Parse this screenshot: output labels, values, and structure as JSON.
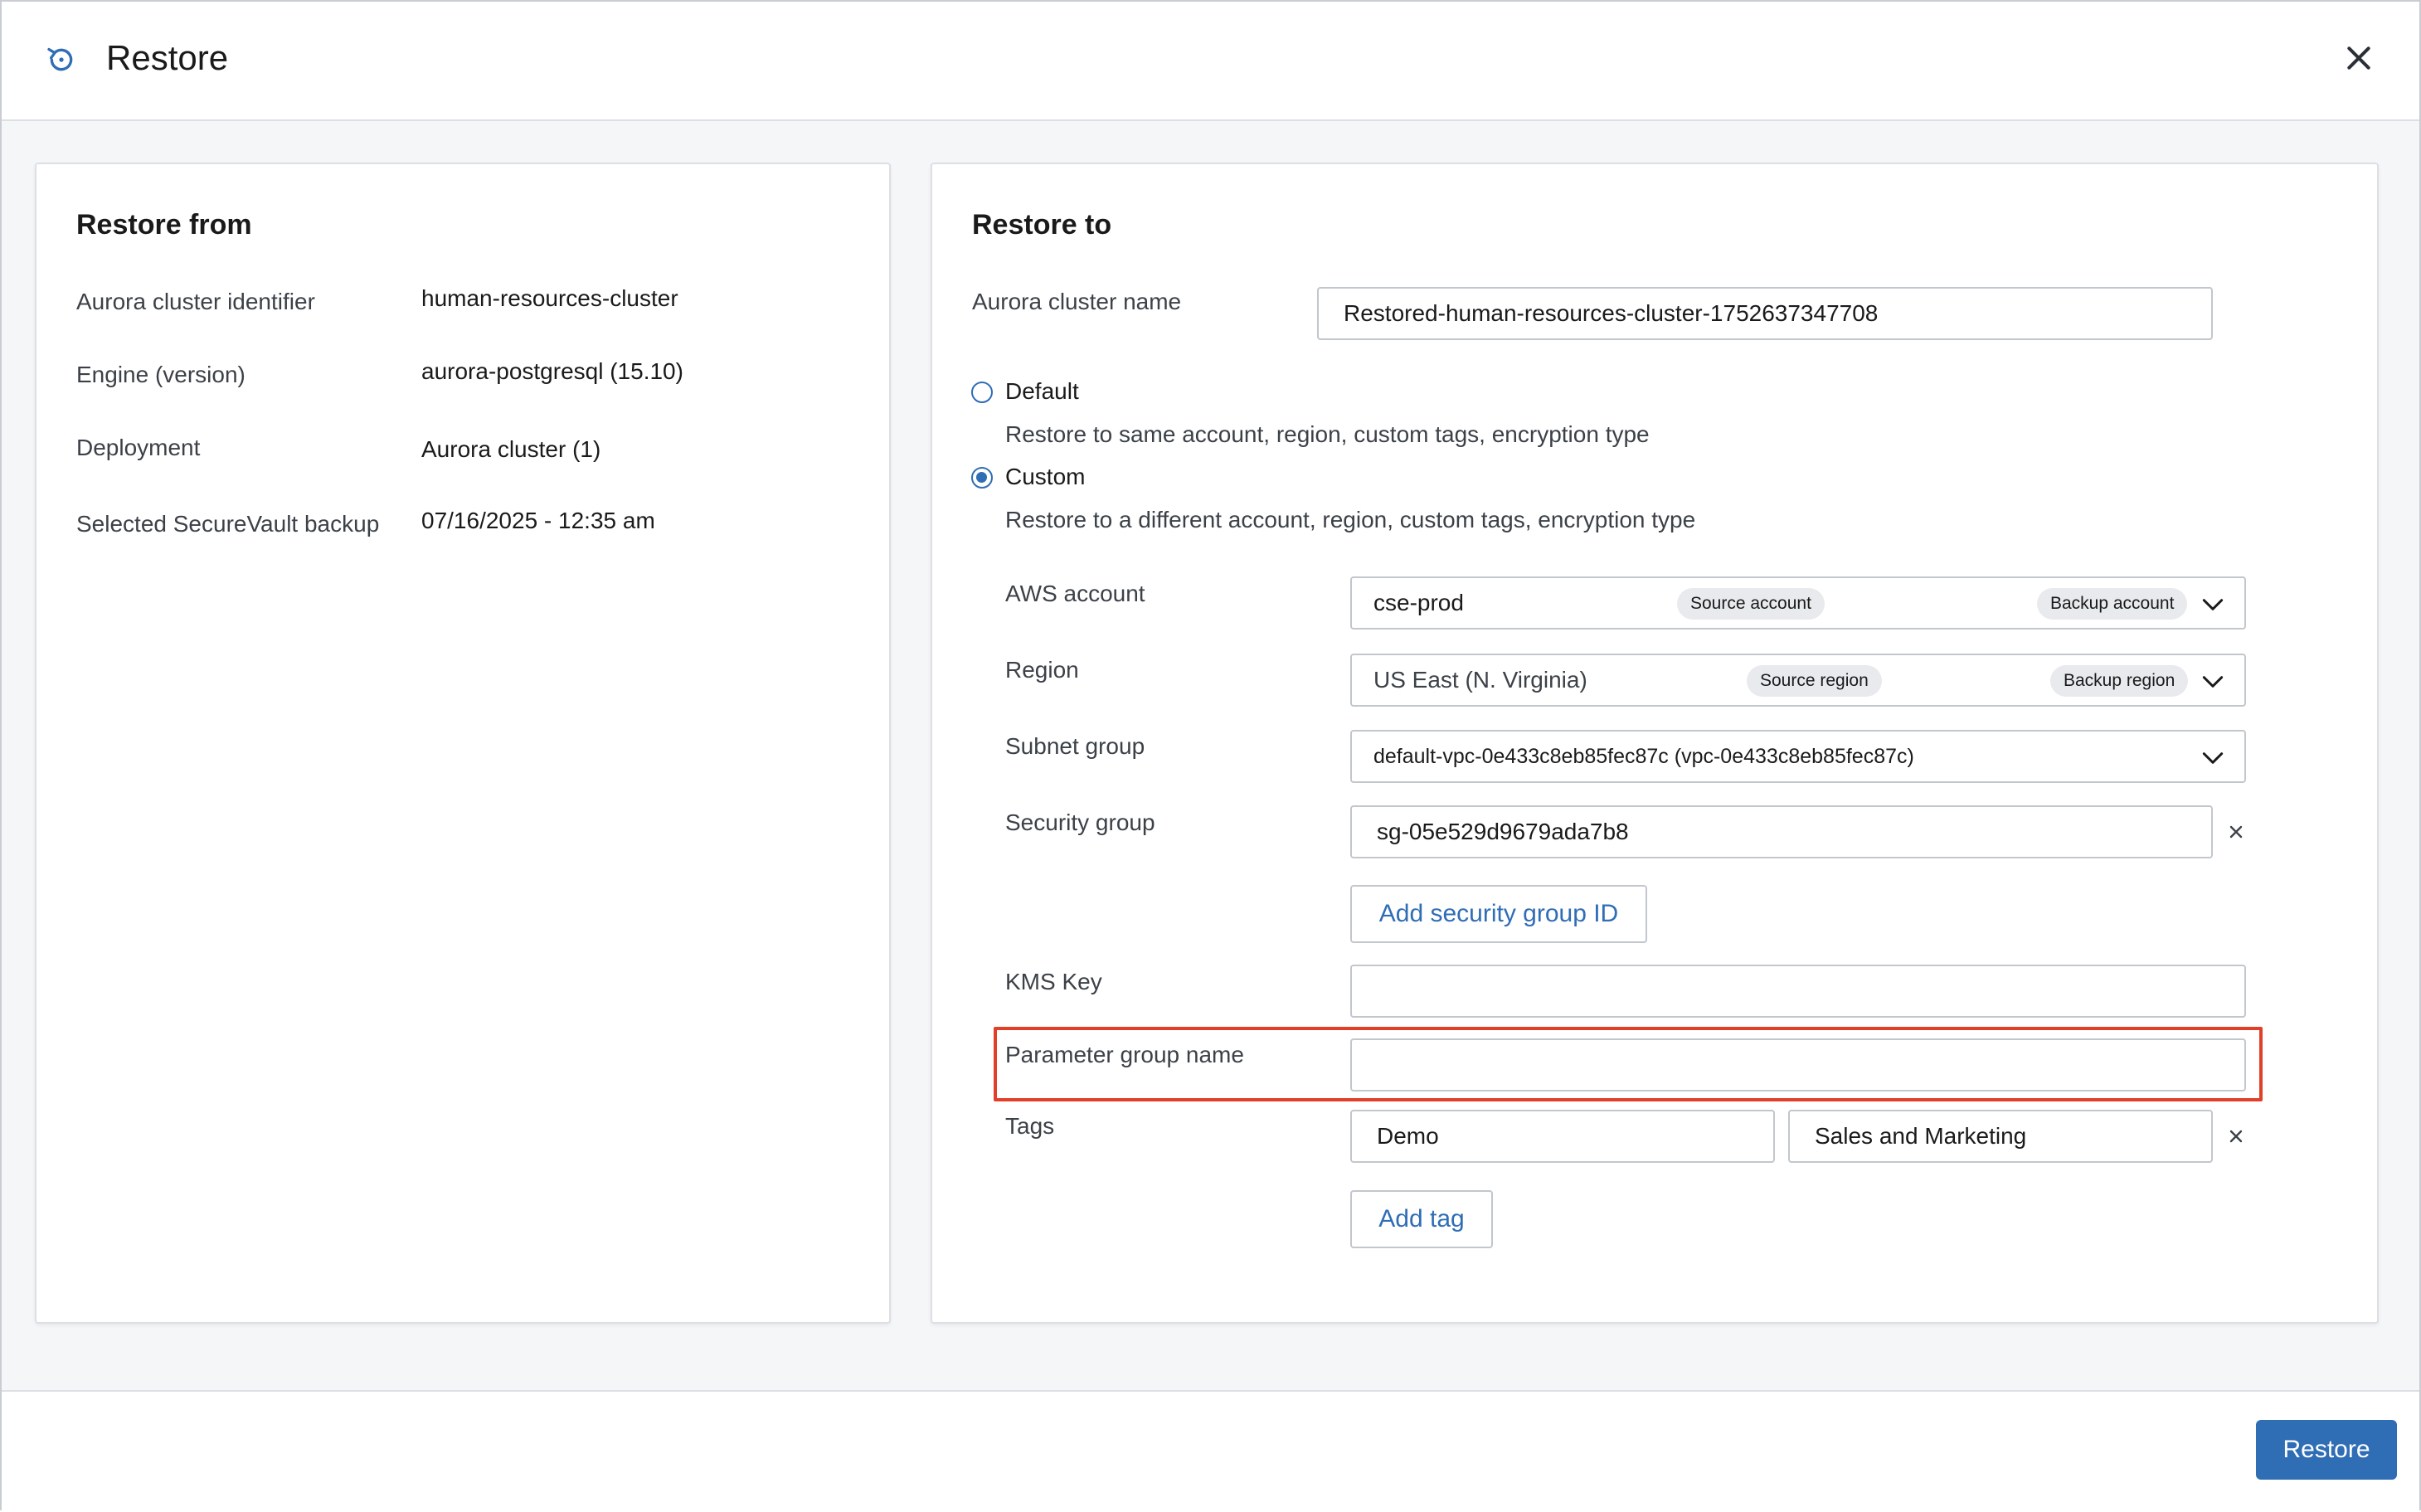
{
  "dialog": {
    "title": "Restore",
    "close_icon": "close-icon",
    "title_icon": "restore-history-icon"
  },
  "restore_from": {
    "heading": "Restore from",
    "rows": [
      {
        "label": "Aurora cluster identifier",
        "value": "human-resources-cluster"
      },
      {
        "label": "Engine (version)",
        "value": "aurora-postgresql (15.10)"
      },
      {
        "label": "Deployment",
        "value": "Aurora cluster (1)"
      },
      {
        "label": "Selected SecureVault backup",
        "value": "07/16/2025 - 12:35 am"
      }
    ]
  },
  "restore_to": {
    "heading": "Restore to",
    "cluster_name_label": "Aurora cluster name",
    "cluster_name_value": "Restored-human-resources-cluster-1752637347708",
    "options": {
      "default_label": "Default",
      "default_desc": "Restore to same account, region, custom tags, encryption type",
      "custom_label": "Custom",
      "custom_desc": "Restore to a different account, region, custom tags, encryption type",
      "selected": "Custom"
    },
    "aws_account": {
      "label": "AWS account",
      "value": "cse-prod",
      "chip1": "Source account",
      "chip2": "Backup account"
    },
    "region": {
      "label": "Region",
      "value": "US East (N. Virginia)",
      "chip1": "Source region",
      "chip2": "Backup region"
    },
    "subnet_group": {
      "label": "Subnet group",
      "value": "default-vpc-0e433c8eb85fec87c (vpc-0e433c8eb85fec87c)"
    },
    "security_group": {
      "label": "Security group",
      "value": "sg-05e529d9679ada7b8",
      "add_label": "Add security group ID"
    },
    "kms_key": {
      "label": "KMS Key",
      "value": ""
    },
    "parameter_group": {
      "label": "Parameter group name",
      "value": "",
      "highlight_color": "#e0402a"
    },
    "tags": {
      "label": "Tags",
      "key": "Demo",
      "value": "Sales and Marketing",
      "add_label": "Add tag"
    }
  },
  "footer": {
    "restore_button": "Restore"
  },
  "colors": {
    "accent": "#2f6db5",
    "highlight": "#e0402a"
  }
}
